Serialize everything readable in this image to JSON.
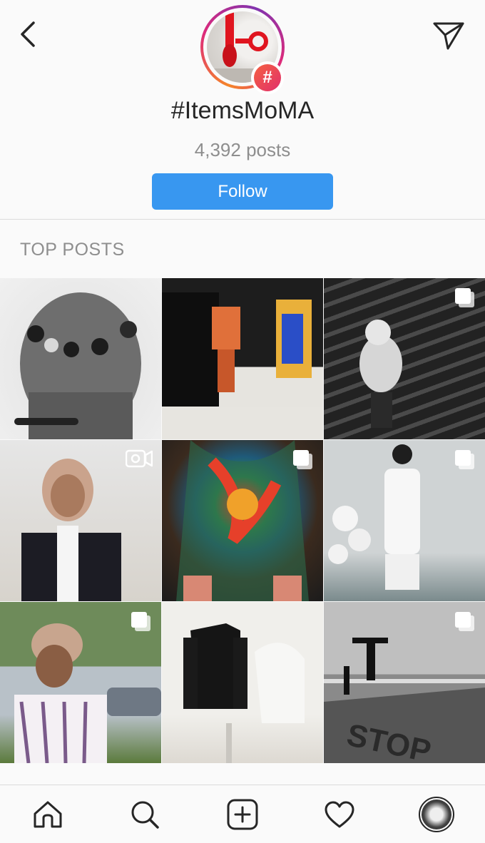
{
  "header": {
    "hashtag": "#ItemsMoMA",
    "post_count": "4,392 posts",
    "follow_label": "Follow",
    "badge_symbol": "#"
  },
  "sections": {
    "top_posts_label": "TOP POSTS"
  },
  "icons": {
    "back": "chevron-left-icon",
    "share": "paper-plane-icon",
    "home": "home-icon",
    "search": "search-icon",
    "new_post": "plus-square-icon",
    "activity": "heart-icon",
    "profile": "profile-avatar"
  },
  "posts": [
    {
      "type": "photo"
    },
    {
      "type": "photo"
    },
    {
      "type": "carousel"
    },
    {
      "type": "video"
    },
    {
      "type": "carousel"
    },
    {
      "type": "carousel"
    },
    {
      "type": "carousel"
    },
    {
      "type": "photo"
    },
    {
      "type": "carousel"
    }
  ],
  "colors": {
    "follow_button": "#3897f0",
    "secondary_text": "#8e8e8e",
    "primary_text": "#262626",
    "hashtag_badge": "#e1306c"
  }
}
